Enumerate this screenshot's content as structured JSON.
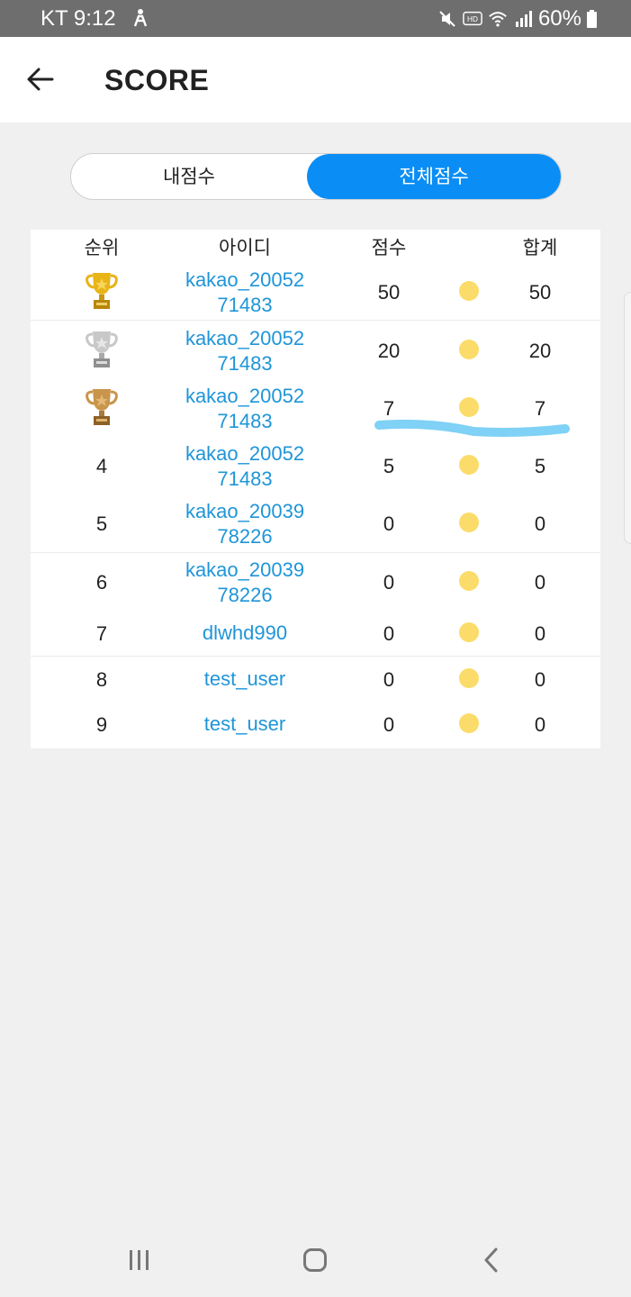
{
  "status_bar": {
    "carrier_time": "KT 9:12",
    "icons": [
      "person-icon",
      "mute-icon",
      "hd-icon",
      "wifi-icon",
      "signal-icon",
      "battery-icon"
    ],
    "hd_label": "HD",
    "battery": "60%"
  },
  "app_bar": {
    "title": "SCORE",
    "back_icon": "arrow-left-icon"
  },
  "tabs": [
    {
      "label": "내점수",
      "selected": false
    },
    {
      "label": "전체점수",
      "selected": true
    }
  ],
  "table": {
    "headers": {
      "rank": "순위",
      "id": "아이디",
      "score": "점수",
      "total": "합계"
    },
    "rows": [
      {
        "rank": "1",
        "trophy": "gold",
        "id": "kakao_2005271483",
        "id_lines": [
          "kakao_20052",
          "71483"
        ],
        "score": "50",
        "total": "50"
      },
      {
        "rank": "2",
        "trophy": "silver",
        "id": "kakao_2005271483",
        "id_lines": [
          "kakao_20052",
          "71483"
        ],
        "score": "20",
        "total": "20"
      },
      {
        "rank": "3",
        "trophy": "bronze",
        "id": "kakao_2005271483",
        "id_lines": [
          "kakao_20052",
          "71483"
        ],
        "score": "7",
        "total": "7"
      },
      {
        "rank": "4",
        "id": "kakao_2005271483",
        "id_lines": [
          "kakao_20052",
          "71483"
        ],
        "score": "5",
        "total": "5"
      },
      {
        "rank": "5",
        "id": "kakao_2003978226",
        "id_lines": [
          "kakao_20039",
          "78226"
        ],
        "score": "0",
        "total": "0"
      },
      {
        "rank": "6",
        "id": "kakao_2003978226",
        "id_lines": [
          "kakao_20039",
          "78226"
        ],
        "score": "0",
        "total": "0"
      },
      {
        "rank": "7",
        "id": "dlwhd990",
        "id_lines": [
          "dlwhd990"
        ],
        "score": "0",
        "total": "0"
      },
      {
        "rank": "8",
        "id": "test_user",
        "id_lines": [
          "test_user"
        ],
        "score": "0",
        "total": "0"
      },
      {
        "rank": "9",
        "id": "test_user",
        "id_lines": [
          "test_user"
        ],
        "score": "0",
        "total": "0"
      }
    ]
  },
  "colors": {
    "accent": "#0a8ef5",
    "link": "#1f95d8",
    "coin": "#fbdc6a",
    "highlight": "#7fd1f5"
  },
  "nav_bar": {
    "icons": [
      "recent-apps-icon",
      "home-icon",
      "back-icon"
    ]
  }
}
